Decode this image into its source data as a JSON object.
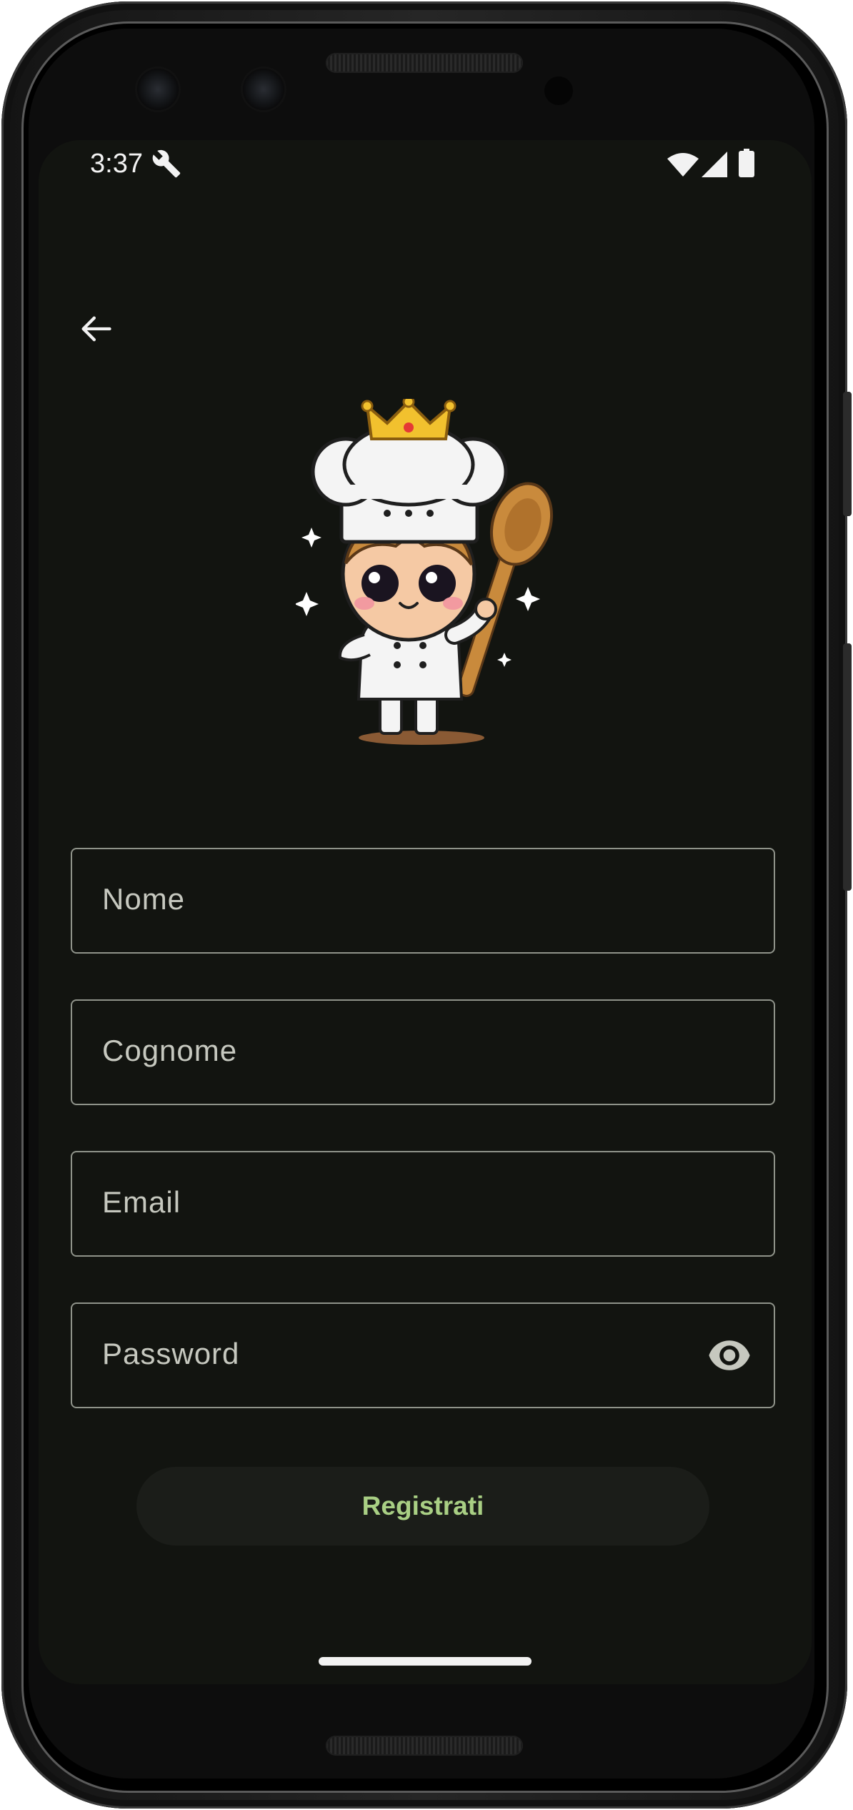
{
  "status_bar": {
    "time": "3:37",
    "icons": [
      "wrench-icon",
      "wifi-icon",
      "signal-icon",
      "battery-icon"
    ]
  },
  "navigation": {
    "back_icon": "arrow-left-icon"
  },
  "mascot": {
    "description_icon": "chef-mascot-logo"
  },
  "form": {
    "fields": [
      {
        "name": "nome",
        "label": "Nome"
      },
      {
        "name": "cognome",
        "label": "Cognome"
      },
      {
        "name": "email",
        "label": "Email"
      },
      {
        "name": "password",
        "label": "Password",
        "trailing_icon": "eye-icon"
      }
    ],
    "submit_label": "Registrati"
  },
  "theme": {
    "background": "#121410",
    "field_border": "#8f938a",
    "label_color": "#c6c8bf",
    "button_background": "#1b1d19",
    "button_text": "#a9cf84"
  }
}
